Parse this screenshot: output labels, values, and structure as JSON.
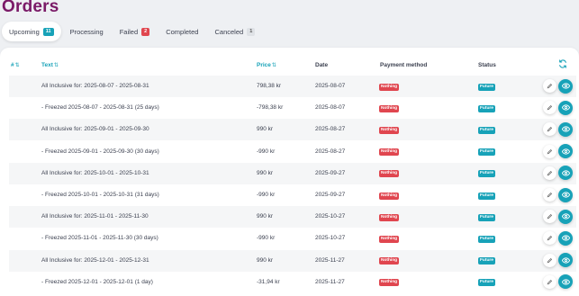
{
  "page": {
    "title": "Orders"
  },
  "tabs": [
    {
      "label": "Upcoming",
      "badge": "11",
      "badge_color": "#17a2b8",
      "active": true
    },
    {
      "label": "Processing",
      "badge": "",
      "active": false
    },
    {
      "label": "Failed",
      "badge": "2",
      "badge_color": "#e0464f",
      "active": false
    },
    {
      "label": "Completed",
      "badge": "",
      "active": false
    },
    {
      "label": "Canceled",
      "badge": "1",
      "badge_color": "#dfe2e6",
      "active": false
    }
  ],
  "table": {
    "headers": {
      "id": "#",
      "text": "Text",
      "price": "Price",
      "date": "Date",
      "payment": "Payment method",
      "status": "Status"
    },
    "rows": [
      {
        "text": "All Inclusive for: 2025-08-07 - 2025-08-31",
        "price": "798,38 kr",
        "date": "2025-08-07",
        "payment": "Nothing",
        "status": "Future"
      },
      {
        "text": "- Freezed 2025-08-07 - 2025-08-31 (25 days)",
        "price": "-798,38 kr",
        "date": "2025-08-07",
        "payment": "Nothing",
        "status": "Future"
      },
      {
        "text": "All Inclusive for: 2025-09-01 - 2025-09-30",
        "price": "990 kr",
        "date": "2025-08-27",
        "payment": "Nothing",
        "status": "Future"
      },
      {
        "text": "- Freezed 2025-09-01 - 2025-09-30 (30 days)",
        "price": "-990 kr",
        "date": "2025-08-27",
        "payment": "Nothing",
        "status": "Future"
      },
      {
        "text": "All Inclusive for: 2025-10-01 - 2025-10-31",
        "price": "990 kr",
        "date": "2025-09-27",
        "payment": "Nothing",
        "status": "Future"
      },
      {
        "text": "- Freezed 2025-10-01 - 2025-10-31 (31 days)",
        "price": "-990 kr",
        "date": "2025-09-27",
        "payment": "Nothing",
        "status": "Future"
      },
      {
        "text": "All Inclusive for: 2025-11-01 - 2025-11-30",
        "price": "990 kr",
        "date": "2025-10-27",
        "payment": "Nothing",
        "status": "Future"
      },
      {
        "text": "- Freezed 2025-11-01 - 2025-11-30 (30 days)",
        "price": "-990 kr",
        "date": "2025-10-27",
        "payment": "Nothing",
        "status": "Future"
      },
      {
        "text": "All Inclusive for: 2025-12-01 - 2025-12-31",
        "price": "990 kr",
        "date": "2025-11-27",
        "payment": "Nothing",
        "status": "Future"
      },
      {
        "text": "- Freezed 2025-12-01 - 2025-12-01 (1 day)",
        "price": "-31,94 kr",
        "date": "2025-11-27",
        "payment": "Nothing",
        "status": "Future"
      }
    ]
  },
  "icons": {
    "sort": "sort-arrows-icon",
    "refresh": "refresh-icon",
    "edit": "pencil-icon",
    "view": "eye-icon"
  },
  "colors": {
    "title": "#7a1a67",
    "accent": "#17a2b8",
    "danger": "#e0464f"
  }
}
